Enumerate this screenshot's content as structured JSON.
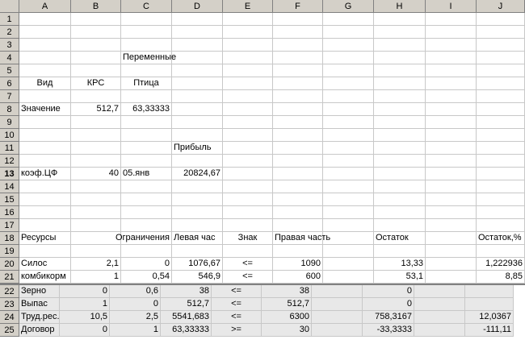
{
  "columns": [
    "A",
    "B",
    "C",
    "D",
    "E",
    "F",
    "G",
    "H",
    "I",
    "J"
  ],
  "rows": [
    "1",
    "2",
    "3",
    "4",
    "5",
    "6",
    "7",
    "8",
    "9",
    "10",
    "11",
    "12",
    "13",
    "14",
    "15",
    "16",
    "17",
    "18",
    "19",
    "20",
    "21",
    "22",
    "23",
    "24",
    "25"
  ],
  "active_row": "13",
  "cells": {
    "r4": {
      "C": "Переменные"
    },
    "r6": {
      "A": "Вид",
      "B": "КРС",
      "C": "Птица"
    },
    "r8": {
      "A": "Значение",
      "B": "512,7",
      "C": "63,33333"
    },
    "r11": {
      "D": "Прибыль"
    },
    "r13": {
      "A": "коэф.ЦФ",
      "B": "40",
      "C": "05.янв",
      "D": "20824,67"
    },
    "r18": {
      "A": "Ресурсы",
      "C": "Ограничения",
      "D": "Левая час",
      "E": "Знак",
      "F": "Правая часть",
      "H": "Остаток",
      "J": "Остаток,%"
    },
    "r20": {
      "A": "Силос",
      "B": "2,1",
      "C": "0",
      "D": "1076,67",
      "E": "<=",
      "F": "1090",
      "H": "13,33",
      "J": "1,222936"
    },
    "r21": {
      "A": "комбикорм",
      "B": "1",
      "C": "0,54",
      "D": "546,9",
      "E": "<=",
      "F": "600",
      "H": "53,1",
      "J": "8,85"
    },
    "r22": {
      "A": "Зерно",
      "B": "0",
      "C": "0,6",
      "D": "38",
      "E": "<=",
      "F": "38",
      "H": "0",
      "J": ""
    },
    "r23": {
      "A": "Выпас",
      "B": "1",
      "C": "0",
      "D": "512,7",
      "E": "<=",
      "F": "512,7",
      "H": "0",
      "J": ""
    },
    "r24": {
      "A": "Труд.рес.",
      "B": "10,5",
      "C": "2,5",
      "D": "5541,683",
      "E": "<=",
      "F": "6300",
      "H": "758,3167",
      "J": "12,0367"
    },
    "r25": {
      "A": "Договор",
      "B": "0",
      "C": "1",
      "D": "63,33333",
      "E": ">=",
      "F": "30",
      "H": "-33,3333",
      "J": "-111,11"
    }
  }
}
